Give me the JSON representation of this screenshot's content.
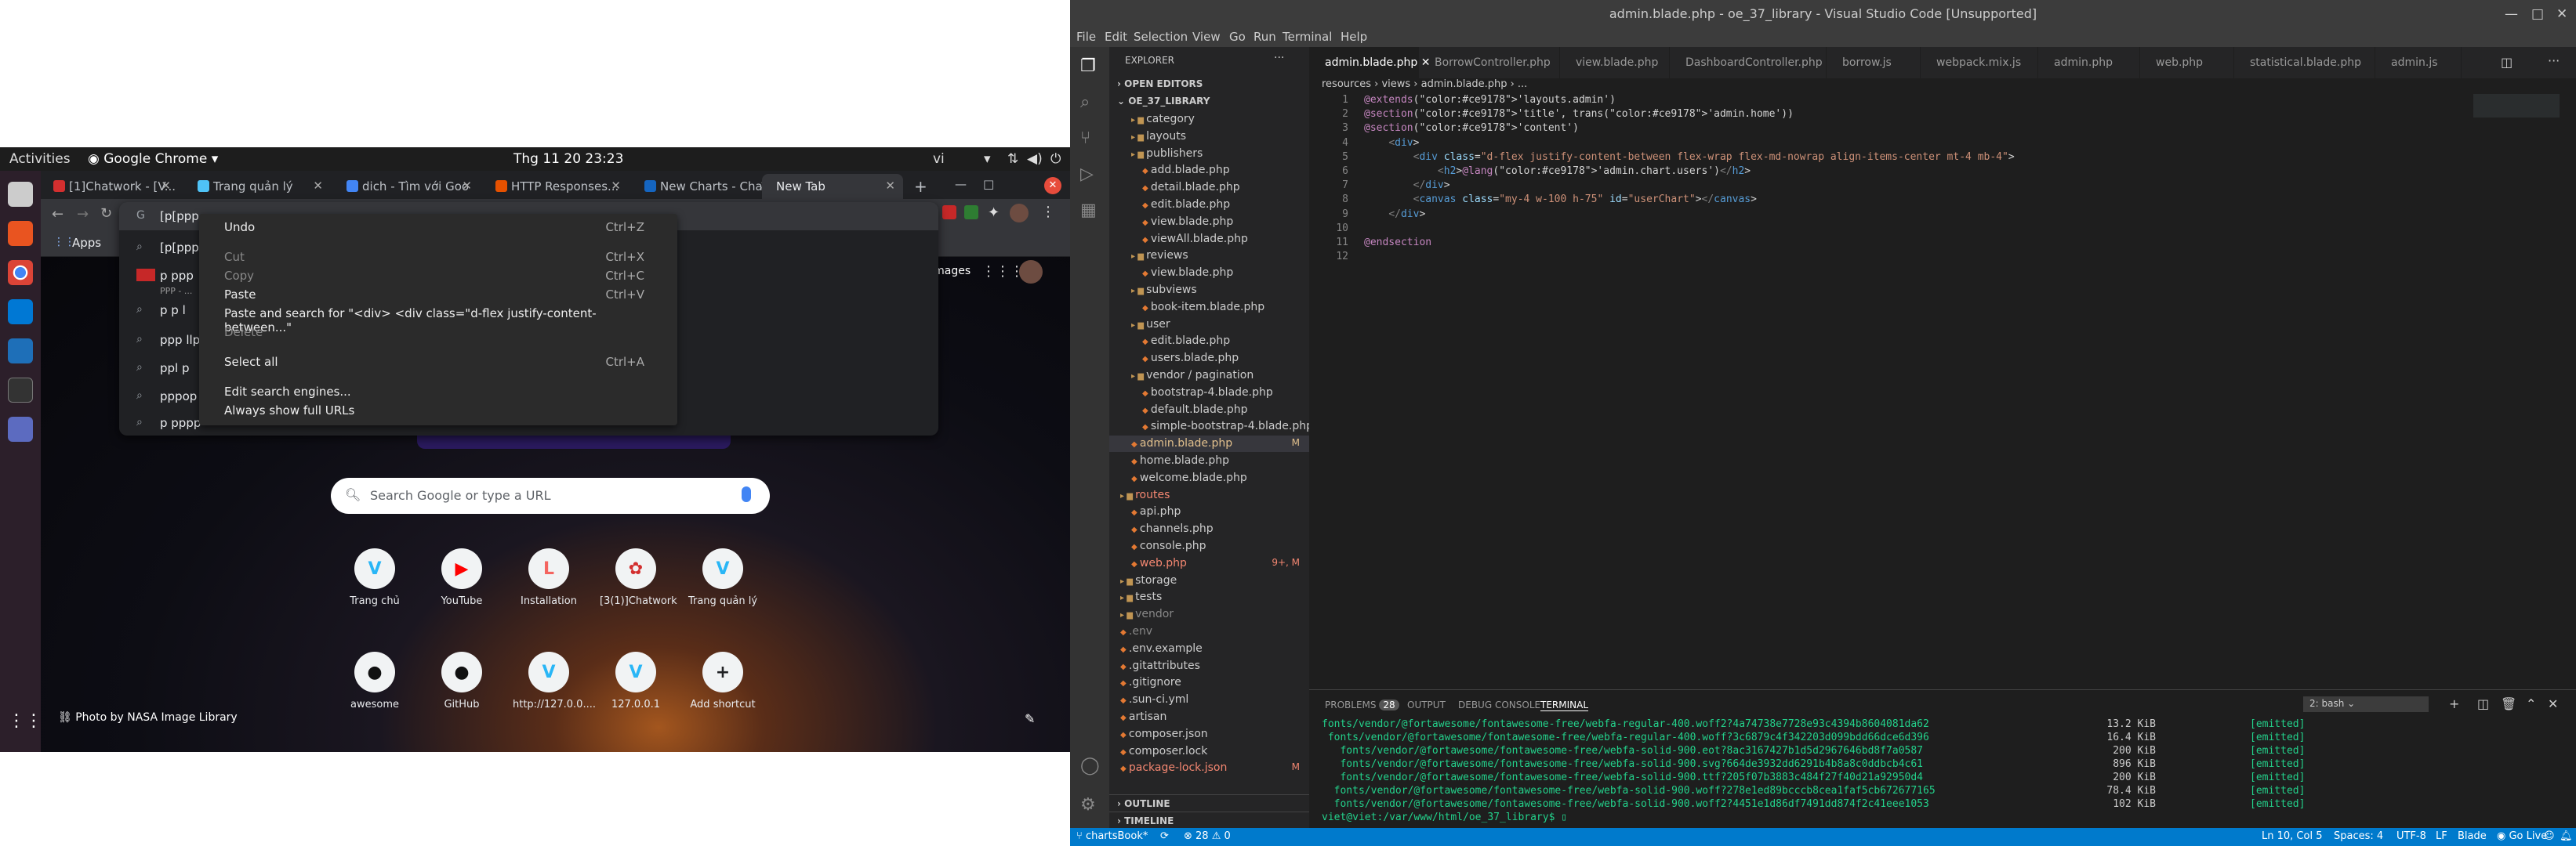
{
  "ubuntu": {
    "activities": "Activities",
    "app": "Google Chrome",
    "clock": "Thg 11 20  23:23",
    "lang": "vi"
  },
  "chrome": {
    "tabs": [
      {
        "label": "[1]Chatwork - [V...",
        "color": "#d32f2f"
      },
      {
        "label": "Trang quản lý",
        "color": "#4fc3f7"
      },
      {
        "label": "dich - Tìm với Goo",
        "color": "#4285f4"
      },
      {
        "label": "HTTP Responses...",
        "color": "#e65100"
      },
      {
        "label": "New Charts - Cha...",
        "color": "#1565c0"
      },
      {
        "label": "New Tab",
        "color": "#5f6368"
      }
    ],
    "address": "[p[ppp",
    "apps_label": "Apps",
    "images_link": "Images",
    "suggestions": [
      {
        "text": "[p[ppp",
        "sub": ""
      },
      {
        "text": "p ppp",
        "sub": "PPP - ..."
      },
      {
        "text": "p p l",
        "sub": ""
      },
      {
        "text": "ppp llp",
        "sub": ""
      },
      {
        "text": "ppl p",
        "sub": ""
      },
      {
        "text": "pppop",
        "sub": ""
      },
      {
        "text": "p pppp",
        "sub": ""
      }
    ],
    "context_menu": {
      "undo": {
        "label": "Undo",
        "key": "Ctrl+Z"
      },
      "cut": {
        "label": "Cut",
        "key": "Ctrl+X"
      },
      "copy": {
        "label": "Copy",
        "key": "Ctrl+C"
      },
      "paste": {
        "label": "Paste",
        "key": "Ctrl+V"
      },
      "paste_search": "Paste and search for \"<div> <div class=\"d-flex justify-content-between...\"",
      "delete": "Delete",
      "select_all": {
        "label": "Select all",
        "key": "Ctrl+A"
      },
      "edit_engines": "Edit search engines...",
      "show_urls": "Always show full URLs"
    },
    "search_placeholder": "Search Google or type a URL",
    "shortcuts": [
      {
        "label": "Trang chủ",
        "glyph": "Ⅴ",
        "color": "#29b6f6"
      },
      {
        "label": "YouTube",
        "glyph": "▶",
        "color": "#ff0000"
      },
      {
        "label": "Installation",
        "glyph": "L",
        "color": "#f4645f"
      },
      {
        "label": "[3(1)]Chatwork",
        "glyph": "✿",
        "color": "#d32f2f"
      },
      {
        "label": "Trang quản lý",
        "glyph": "Ⅴ",
        "color": "#29b6f6"
      },
      {
        "label": "awesome",
        "glyph": "●",
        "color": "#111"
      },
      {
        "label": "GitHub",
        "glyph": "●",
        "color": "#111"
      },
      {
        "label": "http://127.0.0....",
        "glyph": "Ⅴ",
        "color": "#29b6f6"
      },
      {
        "label": "127.0.0.1",
        "glyph": "Ⅴ",
        "color": "#29b6f6"
      },
      {
        "label": "Add shortcut",
        "glyph": "+",
        "color": "#5f6368"
      }
    ],
    "photo_credit": "Photo by NASA Image Library"
  },
  "vscode": {
    "title": "admin.blade.php - oe_37_library - Visual Studio Code [Unsupported]",
    "menu": [
      "File",
      "Edit",
      "Selection",
      "View",
      "Go",
      "Run",
      "Terminal",
      "Help"
    ],
    "explorer_title": "EXPLORER",
    "open_editors": "OPEN EDITORS",
    "project": "OE_37_LIBRARY",
    "tree": [
      {
        "t": "category",
        "d": 1,
        "f": true
      },
      {
        "t": "layouts",
        "d": 1,
        "f": true
      },
      {
        "t": "publishers",
        "d": 1,
        "f": true
      },
      {
        "t": "add.blade.php",
        "d": 2
      },
      {
        "t": "detail.blade.php",
        "d": 2
      },
      {
        "t": "edit.blade.php",
        "d": 2
      },
      {
        "t": "view.blade.php",
        "d": 2
      },
      {
        "t": "viewAll.blade.php",
        "d": 2
      },
      {
        "t": "reviews",
        "d": 1,
        "f": true
      },
      {
        "t": "view.blade.php",
        "d": 2
      },
      {
        "t": "subviews",
        "d": 1,
        "f": true
      },
      {
        "t": "book-item.blade.php",
        "d": 2
      },
      {
        "t": "user",
        "d": 1,
        "f": true
      },
      {
        "t": "edit.blade.php",
        "d": 2
      },
      {
        "t": "users.blade.php",
        "d": 2
      },
      {
        "t": "vendor / pagination",
        "d": 1,
        "f": true
      },
      {
        "t": "bootstrap-4.blade.php",
        "d": 2
      },
      {
        "t": "default.blade.php",
        "d": 2
      },
      {
        "t": "simple-bootstrap-4.blade.php",
        "d": 2
      },
      {
        "t": "admin.blade.php",
        "d": 1,
        "sel": true,
        "m": "M"
      },
      {
        "t": "home.blade.php",
        "d": 1
      },
      {
        "t": "welcome.blade.php",
        "d": 1
      },
      {
        "t": "routes",
        "d": 0,
        "f": true,
        "red": true
      },
      {
        "t": "api.php",
        "d": 1
      },
      {
        "t": "channels.php",
        "d": 1
      },
      {
        "t": "console.php",
        "d": 1
      },
      {
        "t": "web.php",
        "d": 1,
        "red": true,
        "m": "9+, M"
      },
      {
        "t": "storage",
        "d": 0,
        "f": true
      },
      {
        "t": "tests",
        "d": 0,
        "f": true
      },
      {
        "t": "vendor",
        "d": 0,
        "f": true,
        "dim": true
      },
      {
        "t": ".env",
        "d": 0,
        "dim": true
      },
      {
        "t": ".env.example",
        "d": 0
      },
      {
        "t": ".gitattributes",
        "d": 0
      },
      {
        "t": ".gitignore",
        "d": 0
      },
      {
        "t": ".sun-ci.yml",
        "d": 0
      },
      {
        "t": "artisan",
        "d": 0
      },
      {
        "t": "composer.json",
        "d": 0
      },
      {
        "t": "composer.lock",
        "d": 0
      },
      {
        "t": "package-lock.json",
        "d": 0,
        "red": true,
        "m": "M"
      }
    ],
    "outline": "OUTLINE",
    "timeline": "TIMELINE",
    "tabs": [
      "admin.blade.php",
      "BorrowController.php",
      "view.blade.php",
      "DashboardController.php",
      "borrow.js",
      "webpack.mix.js",
      "admin.php",
      "web.php",
      "statistical.blade.php",
      "admin.js"
    ],
    "breadcrumb": "resources › views › admin.blade.php › ...",
    "code": [
      "@extends('layouts.admin')",
      "@section('title', trans('admin.home'))",
      "@section('content')",
      "    <div>",
      "        <div class=\"d-flex justify-content-between flex-wrap flex-md-nowrap align-items-center mt-4 mb-4\">",
      "            <h2>@lang('admin.chart.users')</h2>",
      "        </div>",
      "        <canvas class=\"my-4 w-100 h-75\" id=\"userChart\"></canvas>",
      "    </div>",
      "",
      "@endsection",
      ""
    ],
    "panel_tabs": [
      "PROBLEMS",
      "OUTPUT",
      "DEBUG CONSOLE",
      "TERMINAL"
    ],
    "problems_count": "28",
    "terminal_select": "2: bash",
    "terminal": [
      {
        "file": "fonts/vendor/@fortawesome/fontawesome-free/webfa-regular-400.woff2?4a74738e7728e93c4394b8604081da62",
        "size": "13.2 KiB"
      },
      {
        "file": " fonts/vendor/@fortawesome/fontawesome-free/webfa-regular-400.woff?3c6879c4f342203d099bdd66dce6d396",
        "size": "16.4 KiB"
      },
      {
        "file": "   fonts/vendor/@fortawesome/fontawesome-free/webfa-solid-900.eot?8ac3167427b1d5d2967646bd8f7a0587",
        "size": "200 KiB"
      },
      {
        "file": "   fonts/vendor/@fortawesome/fontawesome-free/webfa-solid-900.svg?664de3932dd6291b4b8a8c0ddbcb4c61",
        "size": "896 KiB"
      },
      {
        "file": "   fonts/vendor/@fortawesome/fontawesome-free/webfa-solid-900.ttf?205f07b3883c484f27f40d21a92950d4",
        "size": "200 KiB"
      },
      {
        "file": "  fonts/vendor/@fortawesome/fontawesome-free/webfa-solid-900.woff?278e1ed89bcccb8cea1faf5cb672677165",
        "size": "78.4 KiB"
      },
      {
        "file": "  fonts/vendor/@fortawesome/fontawesome-free/webfa-solid-900.woff2?4451e1d86df7491dd874f2c41eee1053",
        "size": "102 KiB"
      }
    ],
    "emitted": "[emitted]",
    "prompt": "viet@viet:/var/www/html/oe_37_library$",
    "status": {
      "branch": "chartsBook*",
      "errors": "⊗ 28 ⚠ 0",
      "pos": "Ln 10, Col 5",
      "spaces": "Spaces: 4",
      "enc": "UTF-8",
      "eol": "LF",
      "lang": "Blade",
      "live": "Go Live"
    }
  }
}
